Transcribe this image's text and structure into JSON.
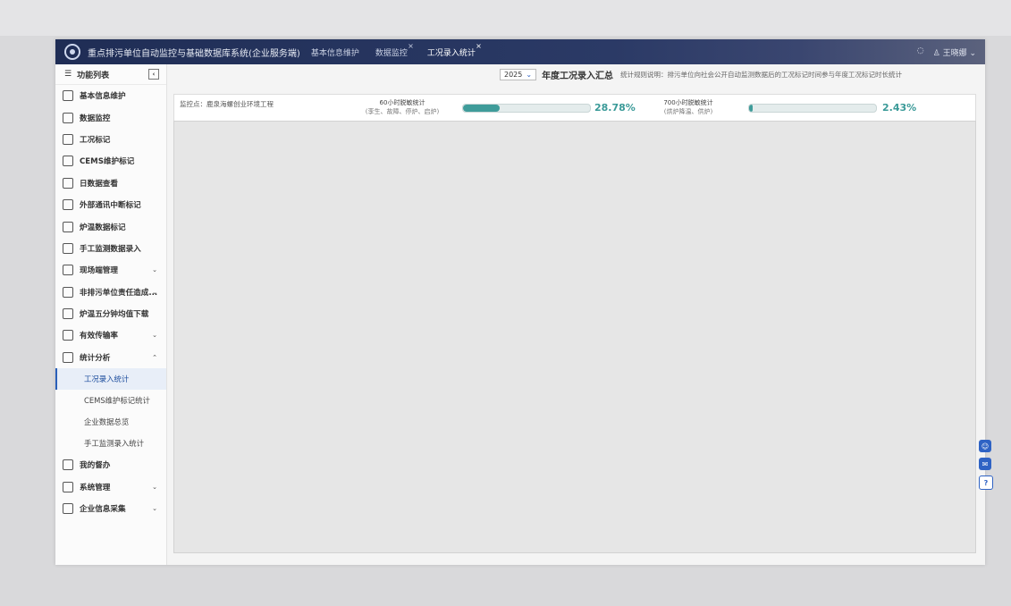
{
  "header": {
    "app_title": "重点排污单位自动监控与基础数据库系统(企业服务端)",
    "tabs": [
      {
        "label": "基本信息维护",
        "closable": false
      },
      {
        "label": "数据监控",
        "closable": true
      },
      {
        "label": "工况录入统计",
        "closable": true,
        "active": true
      }
    ],
    "user_name": "王晓娜"
  },
  "sidebar": {
    "title": "功能列表",
    "items": [
      {
        "label": "基本信息维护"
      },
      {
        "label": "数据监控"
      },
      {
        "label": "工况标记"
      },
      {
        "label": "CEMS维护标记"
      },
      {
        "label": "日数据查看"
      },
      {
        "label": "外部通讯中断标记"
      },
      {
        "label": "炉温数据标记"
      },
      {
        "label": "手工监测数据录入"
      },
      {
        "label": "现场端管理",
        "arrow": "⌄"
      },
      {
        "label": "非排污单位责任造成...",
        "arrow": "⌄"
      },
      {
        "label": "炉温五分钟均值下载"
      },
      {
        "label": "有效传输率",
        "arrow": "⌄"
      },
      {
        "label": "统计分析",
        "arrow": "⌃"
      }
    ],
    "sub_items": [
      {
        "label": "工况录入统计",
        "active": true
      },
      {
        "label": "CEMS维护标记统计"
      },
      {
        "label": "企业数据总览"
      },
      {
        "label": "手工监测录入统计"
      }
    ],
    "items_after": [
      {
        "label": "我的督办"
      },
      {
        "label": "系统管理",
        "arrow": "⌄"
      },
      {
        "label": "企业信息采集",
        "arrow": "⌄"
      }
    ]
  },
  "main": {
    "year": "2025",
    "summary_title": "年度工况录入汇总",
    "rule_text": "统计规则说明：排污单位向社会公开自动监测数据后的工况标记时间参与年度工况标记时长统计",
    "monitor_point": "监控点：鹿泉海螺创业环境工程",
    "stat1": {
      "label": "60小时脱敏统计",
      "sub": "(孪生、故障、停炉、启炉)",
      "percent": "28.78%",
      "fill": 0.2878
    },
    "stat2": {
      "label": "700小时脱敏统计",
      "sub": "(烘炉降温、供炉)",
      "percent": "2.43%",
      "fill": 0.0243
    }
  },
  "floating": {
    "help_label": "?"
  },
  "colors": {
    "titlebar": "#1f2d55",
    "progress_fill": "#3f9c9a",
    "accent": "#2f63c4"
  }
}
